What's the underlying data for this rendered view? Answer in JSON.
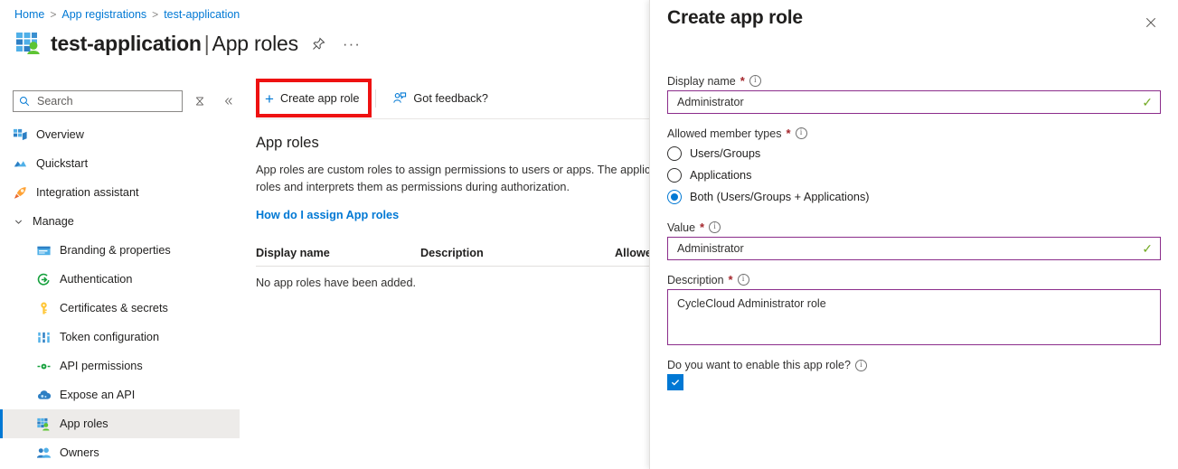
{
  "breadcrumb": {
    "items": [
      {
        "label": "Home"
      },
      {
        "label": "App registrations"
      },
      {
        "label": "test-application"
      }
    ],
    "separator": ">"
  },
  "header": {
    "app_name": "test-application",
    "separator": "|",
    "section": "App roles",
    "pin_icon": "pin-icon",
    "more_icon": "ellipsis-icon",
    "more_label": "···",
    "app_icon": "app-registration-icon"
  },
  "sidebar": {
    "search": {
      "placeholder": "Search",
      "value": "",
      "icon": "search-icon"
    },
    "tools": [
      {
        "name": "hide-search-icon",
        "glyph": "⨯"
      },
      {
        "name": "collapse-nav-icon",
        "glyph": "«"
      }
    ],
    "items": [
      {
        "label": "Overview",
        "icon": "overview-icon",
        "level": 0,
        "selected": false
      },
      {
        "label": "Quickstart",
        "icon": "quickstart-icon",
        "level": 0,
        "selected": false
      },
      {
        "label": "Integration assistant",
        "icon": "rocket-icon",
        "level": 0,
        "selected": false
      },
      {
        "label": "Manage",
        "icon": "chevron-down-icon",
        "level": 0,
        "selected": false,
        "group": true
      },
      {
        "label": "Branding & properties",
        "icon": "branding-icon",
        "level": 1,
        "selected": false
      },
      {
        "label": "Authentication",
        "icon": "authentication-icon",
        "level": 1,
        "selected": false
      },
      {
        "label": "Certificates & secrets",
        "icon": "key-icon",
        "level": 1,
        "selected": false
      },
      {
        "label": "Token configuration",
        "icon": "token-icon",
        "level": 1,
        "selected": false
      },
      {
        "label": "API permissions",
        "icon": "api-permissions-icon",
        "level": 1,
        "selected": false
      },
      {
        "label": "Expose an API",
        "icon": "expose-api-icon",
        "level": 1,
        "selected": false
      },
      {
        "label": "App roles",
        "icon": "app-roles-icon",
        "level": 1,
        "selected": true
      },
      {
        "label": "Owners",
        "icon": "owners-icon",
        "level": 1,
        "selected": false
      }
    ]
  },
  "toolbar": {
    "create_label": "Create app role",
    "create_icon": "plus-icon",
    "feedback_label": "Got feedback?",
    "feedback_icon": "feedback-person-icon",
    "highlight_color": "#ee1111"
  },
  "main": {
    "title": "App roles",
    "description": "App roles are custom roles to assign permissions to users or apps. The application defines and publishes the app roles and interprets them as permissions during authorization.",
    "how_link": "How do I assign App roles",
    "table": {
      "columns": [
        "Display name",
        "Description",
        "Allowed"
      ],
      "empty_message": "No app roles have been added.",
      "rows": []
    }
  },
  "panel": {
    "title": "Create app role",
    "close_icon": "close-icon",
    "close_glyph": "✕",
    "info_glyph": "i",
    "required_marker": "*",
    "fields": {
      "display_name": {
        "label": "Display name",
        "value": "Administrator",
        "valid_icon": "checkmark-icon",
        "valid_glyph": "✓",
        "border_color": "#8b2d8b"
      },
      "allowed_member_types": {
        "label": "Allowed member types",
        "options": [
          {
            "label": "Users/Groups",
            "selected": false
          },
          {
            "label": "Applications",
            "selected": false
          },
          {
            "label": "Both (Users/Groups + Applications)",
            "selected": true
          }
        ]
      },
      "value": {
        "label": "Value",
        "value": "Administrator",
        "valid_icon": "checkmark-icon",
        "valid_glyph": "✓"
      },
      "description": {
        "label": "Description",
        "value": "CycleCloud Administrator role"
      },
      "enable": {
        "label": "Do you want to enable this app role?",
        "checked": true,
        "check_glyph": "✓",
        "accent": "#0078d4"
      }
    }
  }
}
